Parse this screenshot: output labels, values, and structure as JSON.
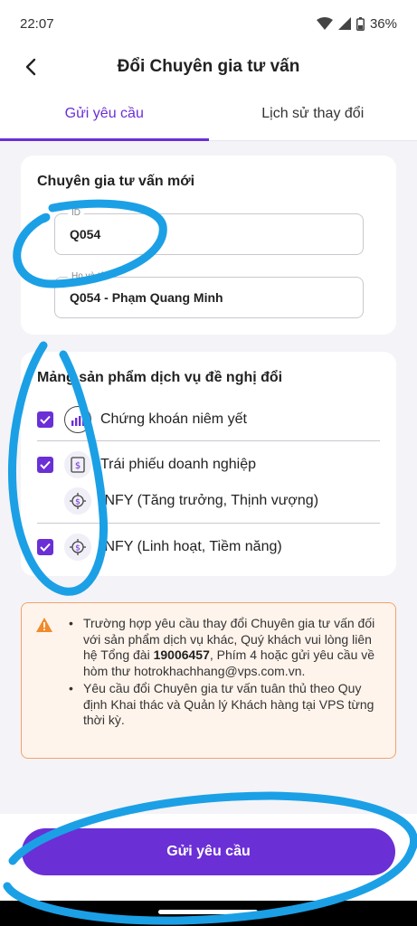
{
  "status_bar": {
    "time": "22:07",
    "battery": "36%"
  },
  "header": {
    "title": "Đổi Chuyên gia tư vấn"
  },
  "tabs": [
    {
      "label": "Gửi yêu cầu",
      "active": true
    },
    {
      "label": "Lịch sử thay đổi",
      "active": false
    }
  ],
  "advisor_card": {
    "title": "Chuyên gia tư vấn mới",
    "id_field": {
      "label": "ID",
      "value": "Q054"
    },
    "name_field": {
      "label": "Họ và tên",
      "value": "Q054 - Phạm Quang Minh"
    }
  },
  "products_card": {
    "title": "Mảng sản phẩm dịch vụ đề nghị đổi",
    "items": [
      {
        "label": "Chứng khoán niêm yết",
        "checked": true,
        "icon": "bar-chart-icon"
      },
      {
        "label": "Trái phiếu doanh nghiệp",
        "checked": true,
        "icon": "bond-document-icon"
      },
      {
        "label": "INFY (Tăng trưởng, Thịnh vượng)",
        "checked": false,
        "icon": "target-dollar-icon"
      },
      {
        "label": "INFY (Linh hoạt, Tiềm năng)",
        "checked": true,
        "icon": "target-dollar-icon"
      }
    ]
  },
  "notice": {
    "item1_part1": "Trường hợp yêu cầu thay đổi Chuyên gia tư vấn đối với sản phẩm dịch vụ khác, Quý khách vui lòng liên hệ Tổng đài ",
    "hotline": "19006457",
    "item1_part2": ", Phím 4 hoặc gửi yêu cầu về hòm thư ",
    "email": "hotrokhachhang@vps.com.vn",
    "item1_part3": ".",
    "item2": "Yêu cầu đổi Chuyên gia tư vấn tuân thủ theo Quy định Khai thác và Quản lý Khách hàng tại VPS từng thời kỳ."
  },
  "submit_button": {
    "label": "Gửi yêu cầu"
  },
  "colors": {
    "accent": "#6b2fd6",
    "annotation": "#1ba0e6",
    "warning": "#f08a2c"
  }
}
